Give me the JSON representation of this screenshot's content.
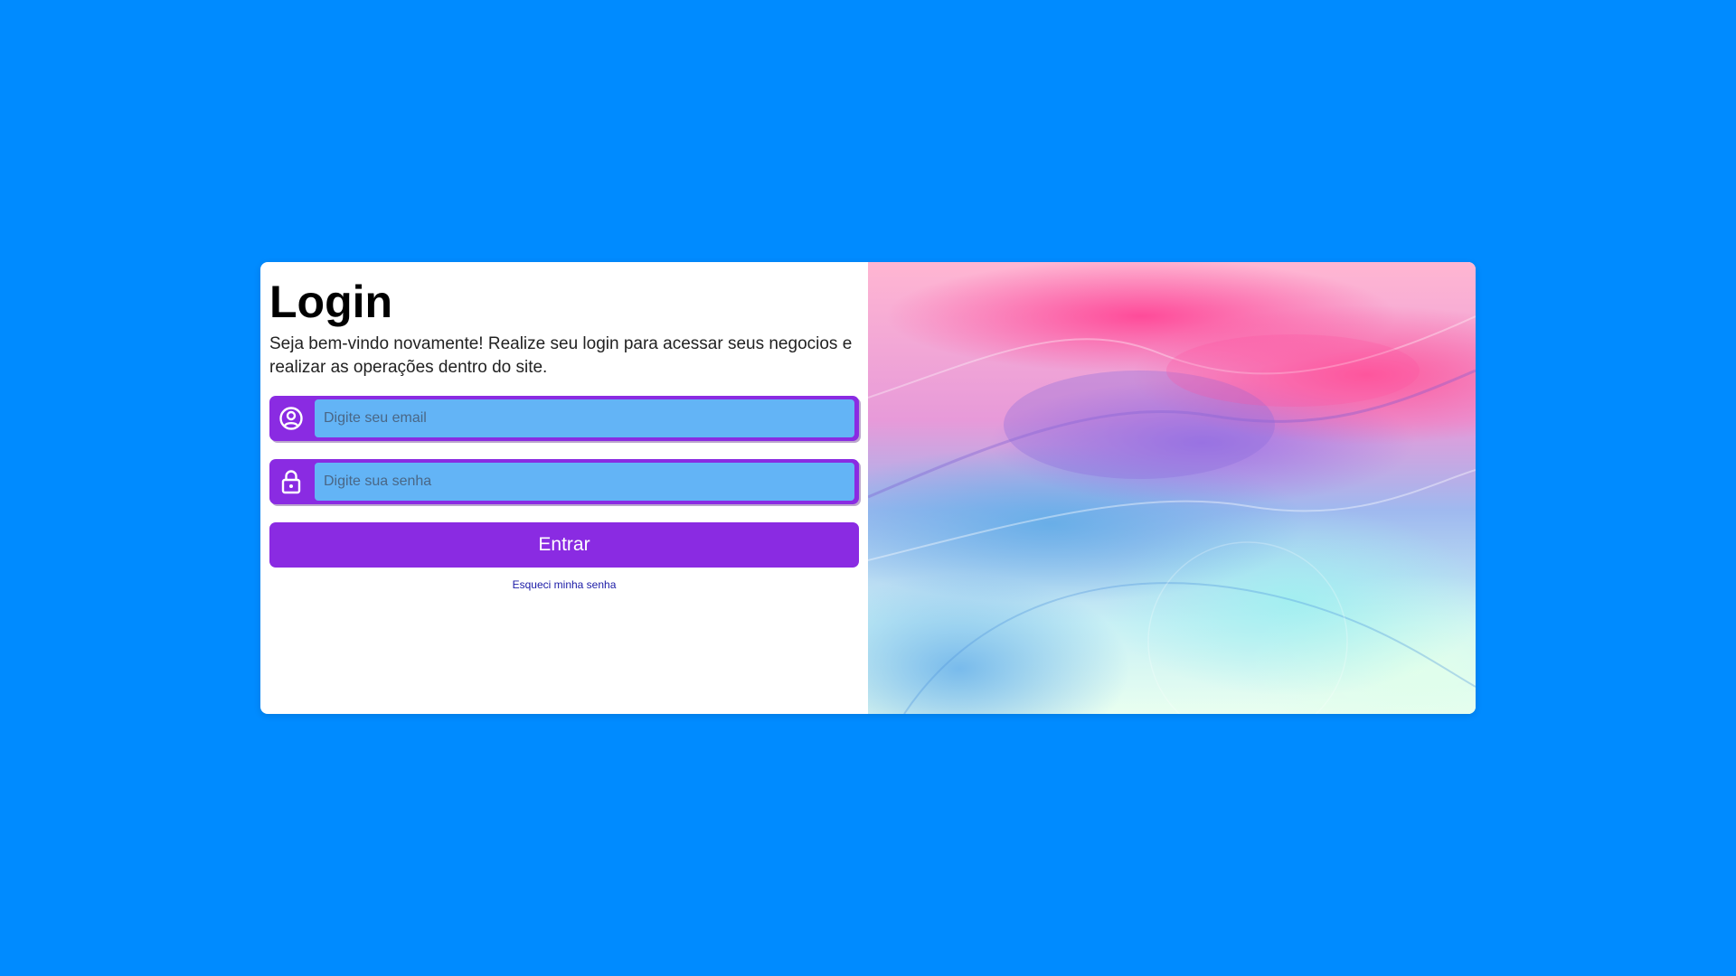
{
  "login": {
    "title": "Login",
    "subtitle": "Seja bem-vindo novamente! Realize seu login para acessar seus negocios e realizar as operações dentro do site.",
    "email_placeholder": "Digite seu email",
    "email_value": "",
    "email_icon": "user-circle-icon",
    "password_placeholder": "Digite sua senha",
    "password_value": "",
    "password_icon": "lock-icon",
    "submit_label": "Entrar",
    "forgot_label": "Esqueci minha senha"
  },
  "colors": {
    "page_background": "#008bff",
    "accent": "#8a2be2",
    "input_background": "#63b4f6",
    "link": "#1a1aa6"
  }
}
